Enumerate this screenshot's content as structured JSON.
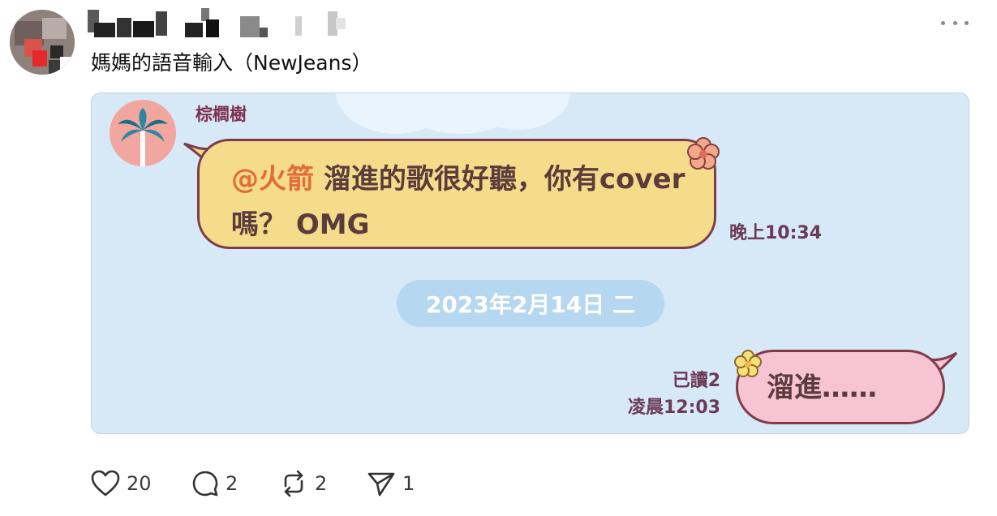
{
  "post": {
    "author_name": "",
    "text": "媽媽的語音輸入（NewJeans）"
  },
  "chat": {
    "sender_name": "棕櫚樹",
    "incoming_message": {
      "mention": "@火箭",
      "text": " 溜進的歌很好聽，你有cover嗎？ OMG",
      "time": "晚上10:34"
    },
    "date_divider": "2023年2月14日 二",
    "outgoing_message": {
      "text": "溜進……",
      "read_status": "已讀2",
      "time": "凌晨12:03"
    }
  },
  "actions": {
    "likes": "20",
    "replies": "2",
    "reposts": "2",
    "shares": "1"
  },
  "colors": {
    "chat_background": "#d7e8f7",
    "incoming_bubble": "#f4dc8a",
    "outgoing_bubble": "#f7c4d3",
    "mention": "#e36c3c",
    "date_pill": "#b5d7ef"
  },
  "icons": [
    "more-icon",
    "heart-icon",
    "reply-icon",
    "repost-icon",
    "share-icon",
    "palm-tree-icon",
    "flower-icon"
  ]
}
